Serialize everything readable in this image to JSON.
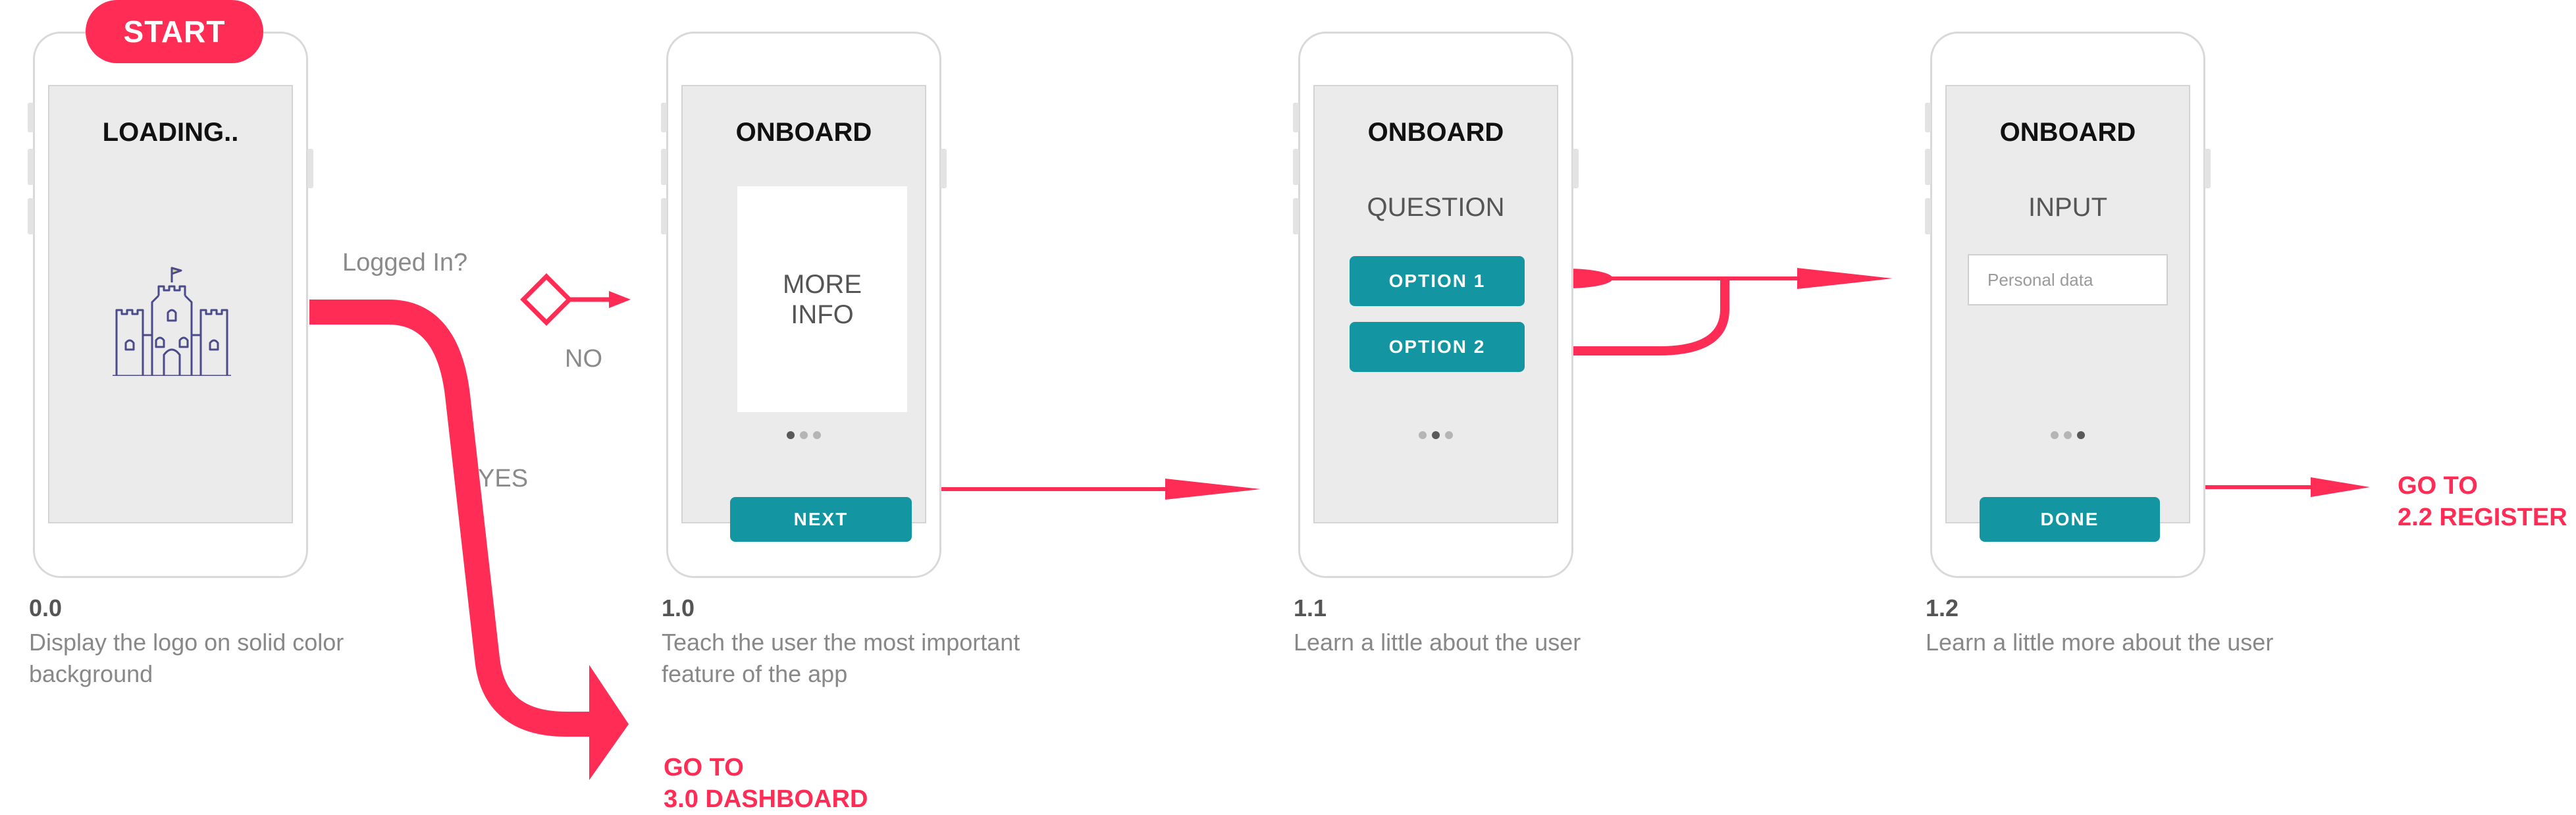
{
  "start_badge": "START",
  "decision": {
    "question": "Logged In?",
    "yes": "YES",
    "no": "NO"
  },
  "screens": [
    {
      "id": "0.0",
      "title": "LOADING..",
      "caption": "Display the logo on solid color background"
    },
    {
      "id": "1.0",
      "title": "ONBOARD",
      "card": "MORE\nINFO",
      "button": "NEXT",
      "dots_active": 0,
      "caption": "Teach the user the most important feature of the app"
    },
    {
      "id": "1.1",
      "title": "ONBOARD",
      "subtitle": "QUESTION",
      "options": [
        "OPTION 1",
        "OPTION 2"
      ],
      "dots_active": 1,
      "caption": "Learn a little about the user"
    },
    {
      "id": "1.2",
      "title": "ONBOARD",
      "subtitle": "INPUT",
      "input_placeholder": "Personal data",
      "button": "DONE",
      "dots_active": 2,
      "caption": "Learn a little more about the user"
    }
  ],
  "goto_dashboard": "GO TO\n3.0 DASHBOARD",
  "goto_register": "GO TO\n2.2 REGISTER",
  "colors": {
    "accent": "#ff2d55",
    "button": "#1396a1",
    "screen_bg": "#ebebeb",
    "frame": "#d9d9d9"
  },
  "icons": {
    "logo": "castle-icon",
    "decision": "diamond-icon"
  }
}
